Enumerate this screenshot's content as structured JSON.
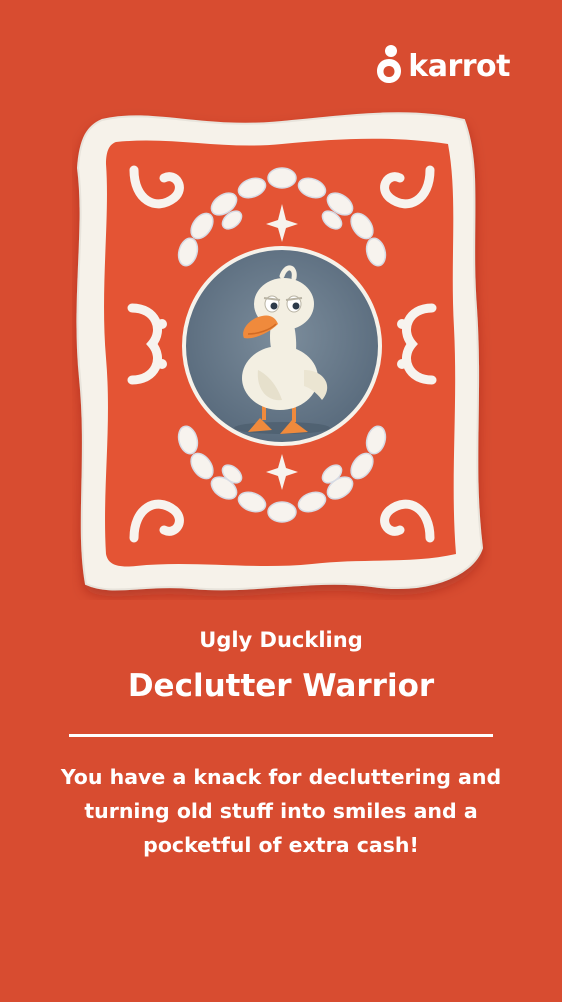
{
  "brand": {
    "name": "karrot"
  },
  "card": {
    "character": "Ugly Duckling",
    "title": "Declutter Warrior",
    "description": "You have a knack for decluttering and turning old stuff into smiles and a pocketful of extra cash!"
  },
  "colors": {
    "background": "#d84c30",
    "frame_inner": "#e45434",
    "frame_border": "#f6f2ea",
    "portrait_bg": "#6a7c8c",
    "accent_text": "#ffffff"
  }
}
